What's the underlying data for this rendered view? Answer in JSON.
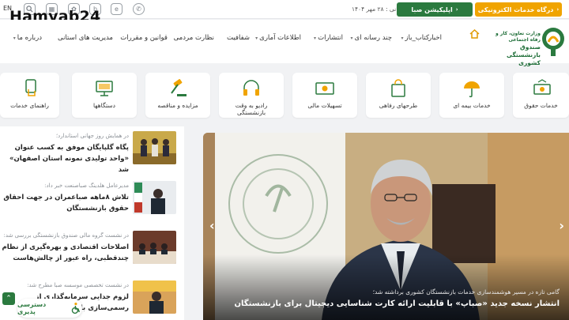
{
  "topbar": {
    "lang": "EN",
    "date_text": "تاریخ آخرین بروز رسانی : ۲۸ مهر ۱۴۰۴",
    "app_button": "اپلیکیشن صبا",
    "portal_button": "درگاه خدمات الکترونیکی"
  },
  "watermark": "Hamyab24",
  "logo": {
    "line1": "وزارت تعاون، کار و رفاه اجتماعی",
    "line2": "صندوق بازنشستگی کشوری"
  },
  "nav": {
    "items": [
      "اخبار",
      "کتاب_باز",
      "چند رسانه ای",
      "انتشارات",
      "اطلاعات آماری",
      "شفافیت",
      "نظارت مردمی",
      "قوانین و مقررات",
      "مدیریت های استانی",
      "درباره ما"
    ]
  },
  "services": [
    "خدمات حقوق",
    "خدمات بیمه ای",
    "طرحهای رفاهی",
    "تسهیلات مالی",
    "رادیو به وقت بازنشستگی",
    "مزایده و مناقصه",
    "دستگاهها",
    "راهنمای خدمات"
  ],
  "news": [
    {
      "kicker": "در همایش روز جهانی استاندارد؛",
      "headline": "پگاه گلپایگان موفق به کسب عنوان «واحد تولیدی نمونه استان اصفهان» شد"
    },
    {
      "kicker": "مدیرعامل هلدینگ صباصنعت خبر داد:",
      "headline": "تلاش ۸ماهه صباعمران در جهت احقاق حقوق بازنشستگان"
    },
    {
      "kicker": "در نشست گروه مالی صندوق بازنشستگی بررسی شد:",
      "headline": "اصلاحات اقتصادی و بهره‌گیری از نظام چندقطبی، راه عبور از چالش‌هاست"
    },
    {
      "kicker": "در نشست تخصصی موسسه صبا مطرح شد:",
      "headline": "لزوم جدایی سرمایه‌گذاری از رسمی‌سازی بازنشستگان از ..."
    }
  ],
  "hero": {
    "kicker": "گامی تازه در مسیر هوشمندسازی خدمات بازنشستگان کشوری برداشته شد؛",
    "title": "انتشار نسخه جدید «صباپ» با قابلیت ارائه کارت شناسایی دیجیتال برای بازنشستگان"
  },
  "accessibility": {
    "label": "دسترسی پذیری"
  },
  "colors": {
    "brand_green": "#2b7a3f",
    "accent_orange": "#f0a400"
  }
}
